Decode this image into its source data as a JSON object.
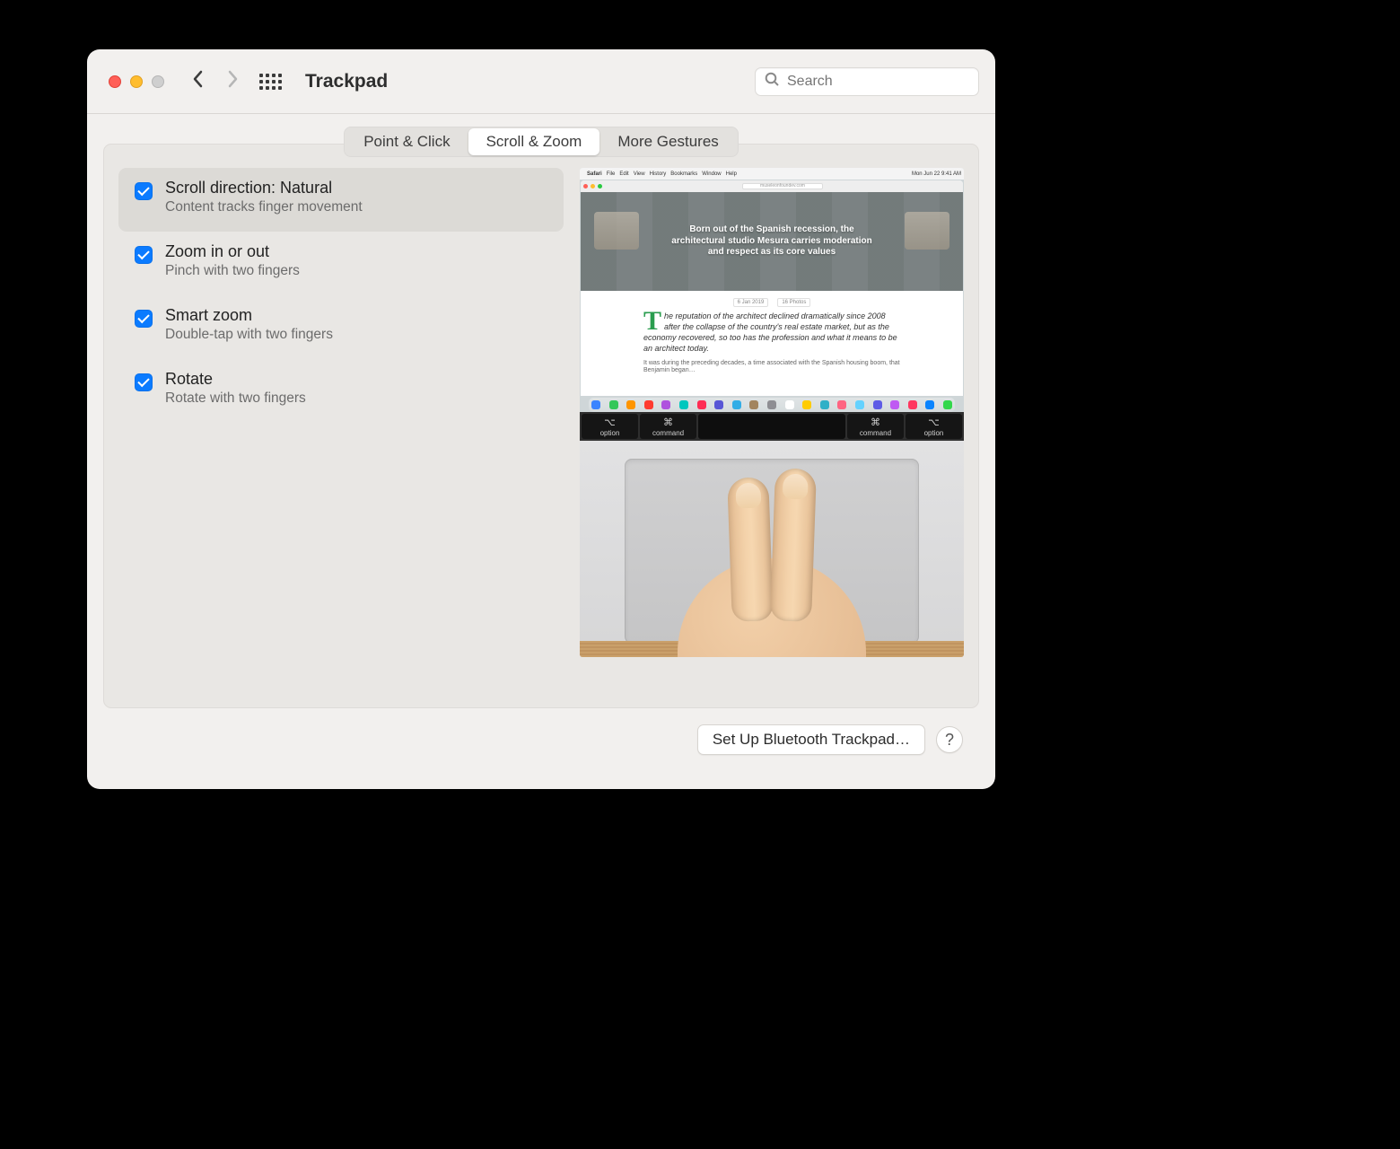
{
  "toolbar": {
    "title": "Trackpad",
    "search_placeholder": "Search"
  },
  "tabs": [
    {
      "label": "Point & Click"
    },
    {
      "label": "Scroll & Zoom"
    },
    {
      "label": "More Gestures"
    }
  ],
  "options": [
    {
      "title": "Scroll direction: Natural",
      "subtitle": "Content tracks finger movement"
    },
    {
      "title": "Zoom in or out",
      "subtitle": "Pinch with two fingers"
    },
    {
      "title": "Smart zoom",
      "subtitle": "Double-tap with two fingers"
    },
    {
      "title": "Rotate",
      "subtitle": "Rotate with two fingers"
    }
  ],
  "preview": {
    "menubar": {
      "apple": "",
      "items": [
        "Safari",
        "File",
        "Edit",
        "View",
        "History",
        "Bookmarks",
        "Window",
        "Help"
      ],
      "clock": "Mon Jun 22  9:41 AM"
    },
    "url": "museleonfoundev.com",
    "hero_line1": "Born out of the Spanish recession, the",
    "hero_line2": "architectural studio Mesura carries moderation",
    "hero_line3": "and respect as its core values",
    "meta_date": "6 Jan 2019",
    "meta_photos": "16 Photos",
    "body_p1": "The reputation of the architect declined dramatically since 2008 after the collapse of the country's real estate market, but as the economy recovered, so too has the profession and what it means to be an architect today.",
    "body_p2": "It was during the preceding decades, a time associated with the Spanish housing boom, that Benjamin began…",
    "keys": [
      {
        "sym": "⌥",
        "label": "option"
      },
      {
        "sym": "⌘",
        "label": "command"
      },
      {
        "sym": "",
        "label": ""
      },
      {
        "sym": "⌘",
        "label": "command"
      },
      {
        "sym": "⌥",
        "label": "option"
      }
    ],
    "dock_colors": [
      "#3a84ff",
      "#34c759",
      "#ff9500",
      "#ff3b30",
      "#af52de",
      "#00c7be",
      "#ff2d55",
      "#5856d6",
      "#32ade6",
      "#a2845e",
      "#8e8e93",
      "#ffffff",
      "#ffcc00",
      "#30b0c7",
      "#ff6482",
      "#64d2ff",
      "#5e5ce6",
      "#bf5af2",
      "#ff375f",
      "#0a84ff",
      "#32d74b"
    ]
  },
  "footer": {
    "setup_button": "Set Up Bluetooth Trackpad…",
    "help": "?"
  }
}
